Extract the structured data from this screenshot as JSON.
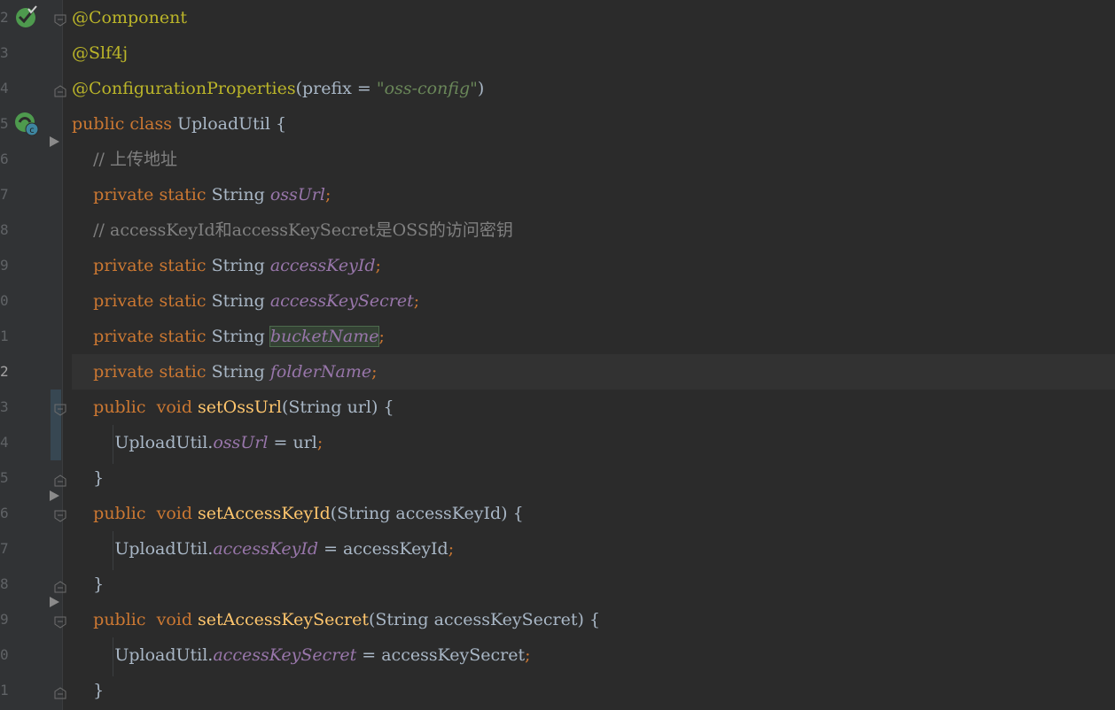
{
  "editor": {
    "lines": [
      {
        "num": "2",
        "tokens": [
          {
            "t": "@Component",
            "c": "annot"
          }
        ]
      },
      {
        "num": "3",
        "tokens": [
          {
            "t": "@Slf4j",
            "c": "annot"
          }
        ]
      },
      {
        "num": "4",
        "tokens": [
          {
            "t": "@ConfigurationProperties",
            "c": "annot"
          },
          {
            "t": "(prefix = ",
            "c": "plain"
          },
          {
            "t": "\"oss-config\"",
            "c": "str"
          },
          {
            "t": ")",
            "c": "plain"
          }
        ]
      },
      {
        "num": "5",
        "tokens": [
          {
            "t": "public class ",
            "c": "kw"
          },
          {
            "t": "UploadUtil {",
            "c": "plain"
          }
        ]
      },
      {
        "num": "6",
        "tokens": [
          {
            "t": "    // 上传地址",
            "c": "cmt"
          }
        ]
      },
      {
        "num": "7",
        "tokens": [
          {
            "t": "    private static ",
            "c": "kw"
          },
          {
            "t": "String ",
            "c": "plain"
          },
          {
            "t": "ossUrl",
            "c": "field"
          },
          {
            "t": ";",
            "c": "kw"
          }
        ]
      },
      {
        "num": "8",
        "tokens": [
          {
            "t": "    // accessKeyId和accessKeySecret是OSS的访问密钥",
            "c": "cmt"
          }
        ]
      },
      {
        "num": "9",
        "tokens": [
          {
            "t": "    private static ",
            "c": "kw"
          },
          {
            "t": "String ",
            "c": "plain"
          },
          {
            "t": "accessKeyId",
            "c": "field"
          },
          {
            "t": ";",
            "c": "kw"
          }
        ]
      },
      {
        "num": "0",
        "tokens": [
          {
            "t": "    private static ",
            "c": "kw"
          },
          {
            "t": "String ",
            "c": "plain"
          },
          {
            "t": "accessKeySecret",
            "c": "field"
          },
          {
            "t": ";",
            "c": "kw"
          }
        ]
      },
      {
        "num": "1",
        "tokens": [
          {
            "t": "    private static ",
            "c": "kw"
          },
          {
            "t": "String ",
            "c": "plain"
          },
          {
            "t": "bucketName",
            "c": "field hl"
          },
          {
            "t": ";",
            "c": "kw"
          }
        ]
      },
      {
        "num": "2",
        "current": true,
        "tokens": [
          {
            "t": "    private static ",
            "c": "kw"
          },
          {
            "t": "String ",
            "c": "plain"
          },
          {
            "t": "folderName",
            "c": "field"
          },
          {
            "t": ";",
            "c": "kw"
          }
        ]
      },
      {
        "num": "3",
        "tokens": [
          {
            "t": "    public  void ",
            "c": "kw"
          },
          {
            "t": "setOssUrl",
            "c": "method"
          },
          {
            "t": "(String url) {",
            "c": "plain"
          }
        ]
      },
      {
        "num": "4",
        "tokens": [
          {
            "t": "        UploadUtil.",
            "c": "plain"
          },
          {
            "t": "ossUrl",
            "c": "field"
          },
          {
            "t": " = url",
            "c": "plain"
          },
          {
            "t": ";",
            "c": "kw"
          }
        ]
      },
      {
        "num": "5",
        "tokens": [
          {
            "t": "    }",
            "c": "plain"
          }
        ]
      },
      {
        "num": "6",
        "tokens": [
          {
            "t": "    public  void ",
            "c": "kw"
          },
          {
            "t": "setAccessKeyId",
            "c": "method"
          },
          {
            "t": "(String accessKeyId) {",
            "c": "plain"
          }
        ]
      },
      {
        "num": "7",
        "tokens": [
          {
            "t": "        UploadUtil.",
            "c": "plain"
          },
          {
            "t": "accessKeyId",
            "c": "field"
          },
          {
            "t": " = accessKeyId",
            "c": "plain"
          },
          {
            "t": ";",
            "c": "kw"
          }
        ]
      },
      {
        "num": "8",
        "tokens": [
          {
            "t": "    }",
            "c": "plain"
          }
        ]
      },
      {
        "num": "9",
        "tokens": [
          {
            "t": "    public  void ",
            "c": "kw"
          },
          {
            "t": "setAccessKeySecret",
            "c": "method"
          },
          {
            "t": "(String accessKeySecret) {",
            "c": "plain"
          }
        ]
      },
      {
        "num": "0",
        "tokens": [
          {
            "t": "        UploadUtil.",
            "c": "plain"
          },
          {
            "t": "accessKeySecret",
            "c": "field"
          },
          {
            "t": " = accessKeySecret",
            "c": "plain"
          },
          {
            "t": ";",
            "c": "kw"
          }
        ]
      },
      {
        "num": "1",
        "tokens": [
          {
            "t": "    }",
            "c": "plain"
          }
        ]
      }
    ]
  },
  "colors": {
    "background": "#2b2b2b",
    "gutter": "#313335",
    "annotation": "#bbb529",
    "keyword": "#cc7832",
    "string": "#6a8759",
    "comment": "#808080",
    "field": "#9876aa",
    "method": "#ffc66d",
    "text": "#a9b7c6"
  },
  "gutter_icons": [
    "spring-bean-check-icon",
    "spring-class-icon"
  ]
}
